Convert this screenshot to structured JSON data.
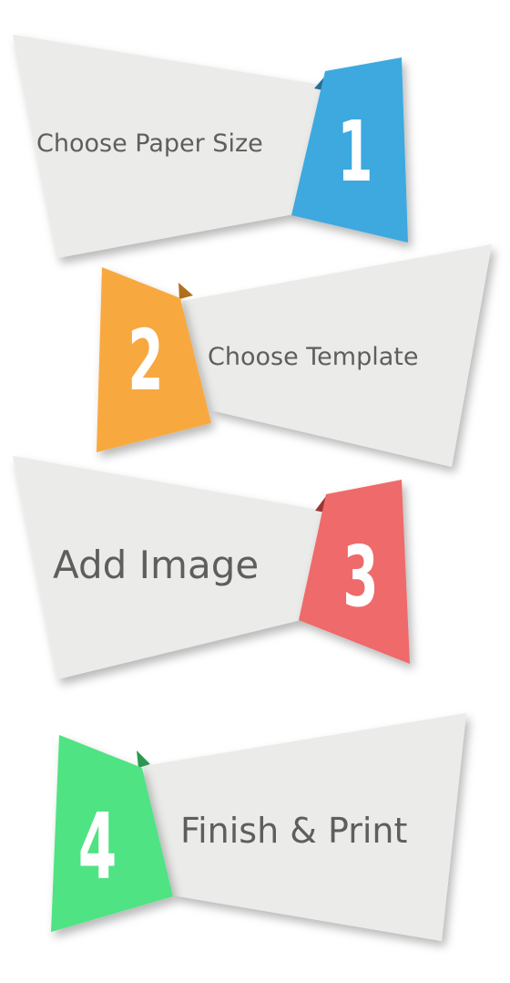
{
  "steps": [
    {
      "number": "1",
      "label": "Choose Paper Size",
      "color": "#3ea9de",
      "fold_color": "#2a6f96"
    },
    {
      "number": "2",
      "label": "Choose Template",
      "color": "#f7a941",
      "fold_color": "#b0701c"
    },
    {
      "number": "3",
      "label": "Add Image",
      "color": "#ef6b6b",
      "fold_color": "#9c3636"
    },
    {
      "number": "4",
      "label": "Finish & Print",
      "color": "#4fe383",
      "fold_color": "#2a9a50"
    }
  ],
  "colors": {
    "banner": "#ebebe9",
    "text": "#5e5e5c",
    "background": "#ffffff"
  }
}
